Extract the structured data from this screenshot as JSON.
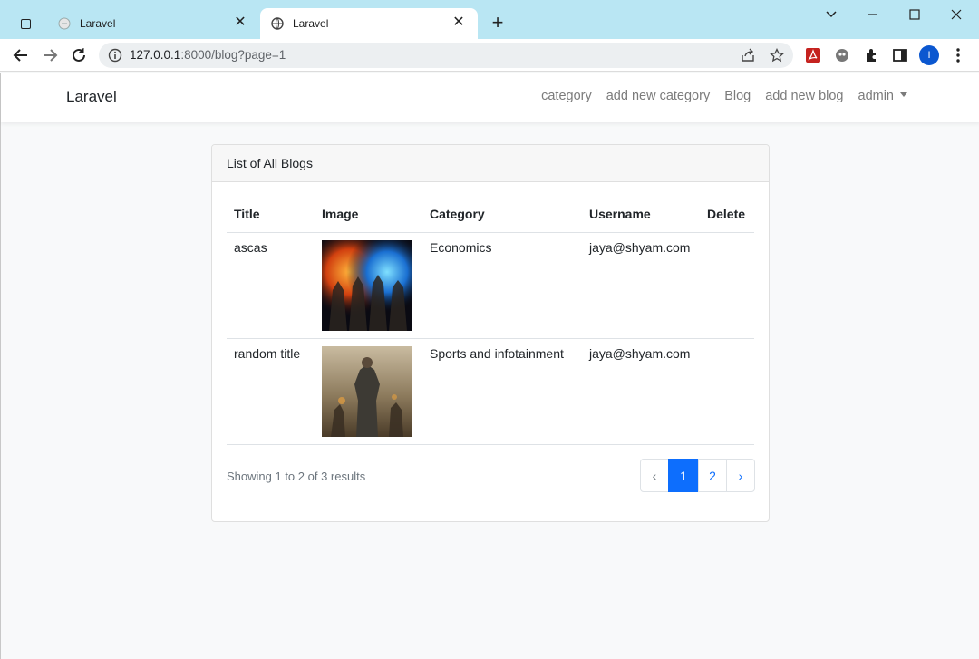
{
  "browser": {
    "tabs": [
      {
        "title": "Laravel",
        "active": false
      },
      {
        "title": "Laravel",
        "active": true
      }
    ],
    "url_host": "127.0.0.1",
    "url_rest": ":8000/blog?page=1",
    "profile_initial": "I"
  },
  "navbar": {
    "brand": "Laravel",
    "links": [
      "category",
      "add new category",
      "Blog",
      "add new blog"
    ],
    "user_menu": "admin"
  },
  "card": {
    "header": "List of All Blogs",
    "columns": [
      "Title",
      "Image",
      "Category",
      "Username",
      "Delete"
    ],
    "rows": [
      {
        "title": "ascas",
        "image": "blog-image-1",
        "category": "Economics",
        "username": "jaya@shyam.com"
      },
      {
        "title": "random title",
        "image": "blog-image-2",
        "category": "Sports and infotainment",
        "username": "jaya@shyam.com"
      }
    ],
    "results_text": "Showing 1 to 2 of 3 results",
    "pagination": {
      "prev": "‹",
      "pages": [
        "1",
        "2"
      ],
      "current": "1",
      "next": "›"
    }
  },
  "colors": {
    "tabstrip": "#b9e6f3",
    "primary": "#0d6efd",
    "profile": "#0b57d0"
  }
}
